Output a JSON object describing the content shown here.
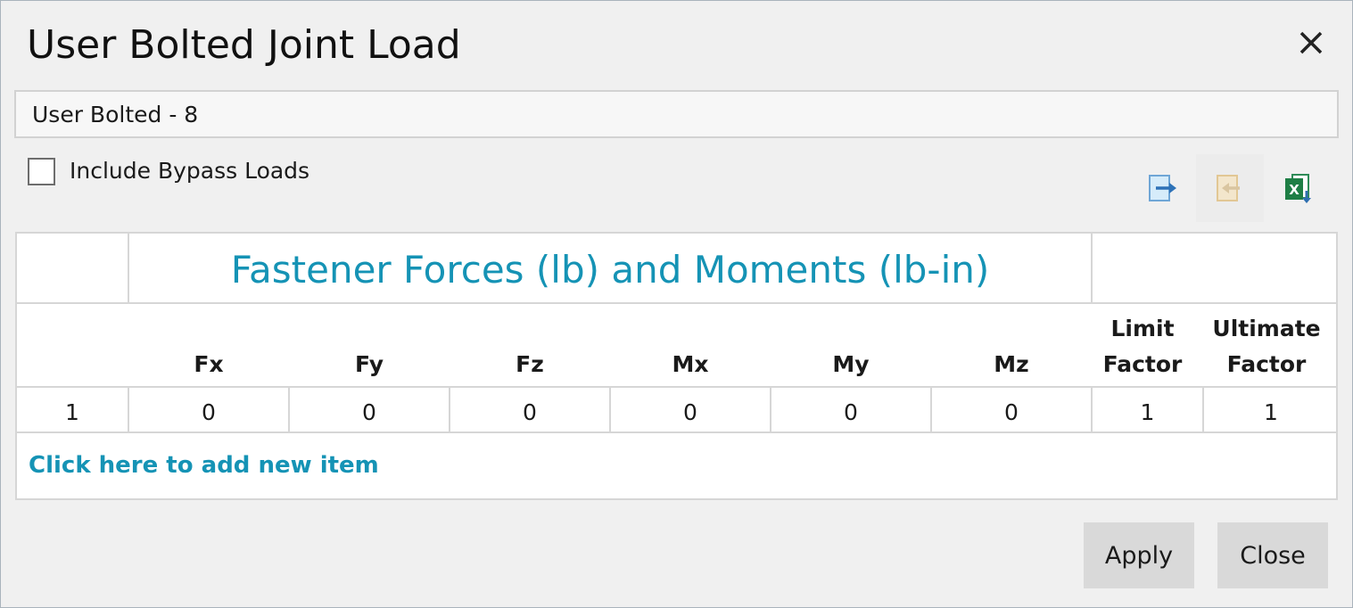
{
  "window": {
    "title": "User Bolted Joint Load",
    "close_icon": "close-icon"
  },
  "name_field": {
    "value": "User Bolted - 8"
  },
  "bypass": {
    "label": "Include Bypass Loads",
    "checked": false
  },
  "toolbar": {
    "export_icon": "export-arrow-icon",
    "import_icon": "import-arrow-icon",
    "excel_icon": "excel-export-icon"
  },
  "grid": {
    "group_title": "Fastener Forces (lb) and Moments (lb-in)",
    "columns": [
      "",
      "Fx",
      "Fy",
      "Fz",
      "Mx",
      "My",
      "Mz",
      "Limit Factor",
      "Ultimate Factor"
    ],
    "rows": [
      [
        "1",
        "0",
        "0",
        "0",
        "0",
        "0",
        "0",
        "1",
        "1"
      ]
    ],
    "add_item_text": "Click here to add new item"
  },
  "buttons": {
    "apply": "Apply",
    "close": "Close"
  },
  "colors": {
    "accent": "#1593b5",
    "background": "#f0f0f0",
    "button": "#d9d9d9",
    "grid_line": "#d6d6d6"
  }
}
